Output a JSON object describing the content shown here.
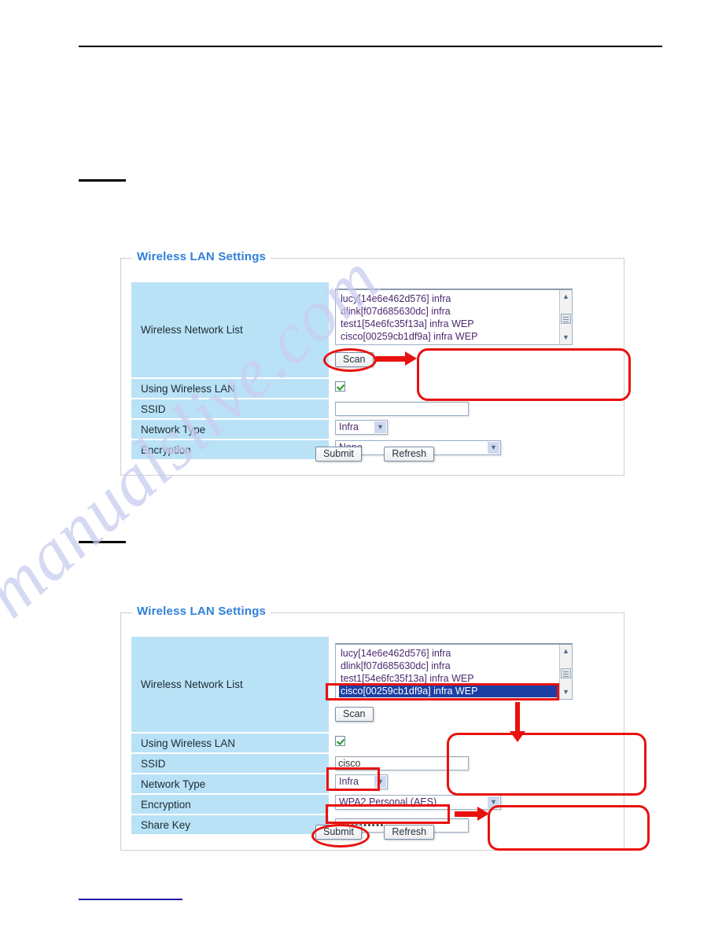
{
  "page": {
    "watermark_text": "manualslive.com"
  },
  "panels": [
    {
      "legend": "Wireless LAN Settings",
      "rows": {
        "network_list_label": "Wireless Network List",
        "using_wireless_label": "Using Wireless LAN",
        "ssid_label": "SSID",
        "network_type_label": "Network Type",
        "encryption_label": "Encryption"
      },
      "network_list": [
        "lucy[14e6e462d576] infra",
        "dlink[f07d685630dc] infra",
        "test1[54e6fc35f13a] infra WEP",
        "cisco[00259cb1df9a] infra WEP"
      ],
      "selected_index": -1,
      "scan_label": "Scan",
      "using_wireless_checked": true,
      "ssid_value": "",
      "network_type_value": "Infra",
      "encryption_value": "None",
      "submit_label": "Submit",
      "refresh_label": "Refresh"
    },
    {
      "legend": "Wireless LAN Settings",
      "rows": {
        "network_list_label": "Wireless Network List",
        "using_wireless_label": "Using Wireless LAN",
        "ssid_label": "SSID",
        "network_type_label": "Network Type",
        "encryption_label": "Encryption",
        "share_key_label": "Share Key"
      },
      "network_list": [
        "lucy[14e6e462d576] infra",
        "dlink[f07d685630dc] infra",
        "test1[54e6fc35f13a] infra WEP",
        "cisco[00259cb1df9a] infra WEP"
      ],
      "selected_index": 3,
      "scan_label": "Scan",
      "using_wireless_checked": true,
      "ssid_value": "cisco",
      "network_type_value": "Infra",
      "encryption_value": "WPA2 Personal (AES)",
      "share_key_value": "•••••••••••",
      "submit_label": "Submit",
      "refresh_label": "Refresh"
    }
  ],
  "annotations": {
    "callout_1_text": "",
    "callout_2_text": "",
    "callout_3_text": ""
  },
  "colors": {
    "legend_blue": "#2f7fd8",
    "row_label_bg": "#b9e2f6",
    "annotation_red": "#e8110f",
    "selection_blue": "#1c3fa3",
    "link_blue": "#1a1aa8"
  }
}
